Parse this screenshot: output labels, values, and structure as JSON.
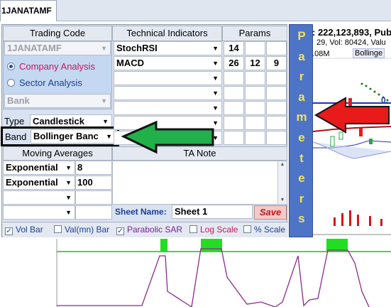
{
  "tab": {
    "label": "1JANATAMF"
  },
  "stock_info": {
    "line1": ": 222,123,893, Pub",
    "line2": "29, Vol: 80424, Valu",
    "vol_label": "0.08M",
    "bollinger_label": "Bollinge",
    "price_label": "0."
  },
  "headers": {
    "trading_code": "Trading Code",
    "technical_indicators": "Technical Indicators",
    "params": "Params",
    "moving_averages": "Moving Averages",
    "ta_note": "TA Note"
  },
  "trading": {
    "code_value": "1JANATAMF",
    "company_analysis": "Company Analysis",
    "sector_analysis": "Sector Analysis",
    "sector_value": "Bank",
    "type_label": "Type",
    "type_value": "Candlestick",
    "band_label": "Band",
    "band_value": "Bollinger Banc"
  },
  "indicators": [
    {
      "name": "StochRSI",
      "params": [
        "14",
        "",
        ""
      ]
    },
    {
      "name": "MACD",
      "params": [
        "26",
        "12",
        "9"
      ]
    },
    {
      "name": "",
      "params": [
        "",
        "",
        ""
      ]
    },
    {
      "name": "",
      "params": [
        "",
        "",
        ""
      ]
    },
    {
      "name": "",
      "params": [
        "",
        "",
        ""
      ]
    },
    {
      "name": "",
      "params": [
        "",
        "",
        ""
      ]
    },
    {
      "name": "",
      "params": [
        "",
        "",
        ""
      ]
    }
  ],
  "moving_averages": [
    {
      "type": "Exponential",
      "period": "8"
    },
    {
      "type": "Exponential",
      "period": "100"
    },
    {
      "type": "",
      "period": ""
    },
    {
      "type": "",
      "period": ""
    }
  ],
  "sheet": {
    "label": "Sheet Name:",
    "value": "Sheet 1",
    "save": "Save"
  },
  "checkboxes": [
    {
      "label": "Vol Bar",
      "checked": true,
      "color": "#1d3f95"
    },
    {
      "label": "Val(mn) Bar",
      "checked": false,
      "color": "#1d3f95"
    },
    {
      "label": "Parabolic SAR",
      "checked": true,
      "color": "#7a1e9a"
    },
    {
      "label": "Log Scale",
      "checked": false,
      "color": "#c2185b"
    },
    {
      "label": "% Scale",
      "checked": false,
      "color": "#1d3f95"
    }
  ],
  "params_vertical": [
    "P",
    "a",
    "r",
    "a",
    "m",
    "e",
    "t",
    "e",
    "r",
    "s"
  ],
  "colors": {
    "accent_blue": "#4e74c7",
    "letters": "#f2e25a",
    "arrow_red": "#e81a1a",
    "arrow_green": "#22b04b",
    "company_analysis": "#c2185b",
    "sector_analysis": "#1d3f95"
  }
}
